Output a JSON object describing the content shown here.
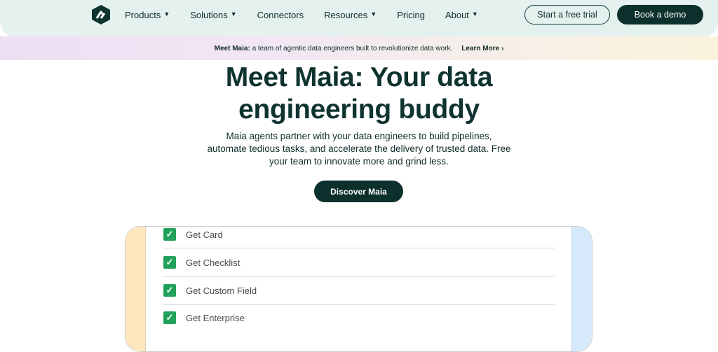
{
  "nav": {
    "items": [
      {
        "label": "Products",
        "dropdown": true
      },
      {
        "label": "Solutions",
        "dropdown": true
      },
      {
        "label": "Connectors",
        "dropdown": false
      },
      {
        "label": "Resources",
        "dropdown": true
      },
      {
        "label": "Pricing",
        "dropdown": false
      },
      {
        "label": "About",
        "dropdown": true
      }
    ],
    "trial_label": "Start a free trial",
    "demo_label": "Book a demo"
  },
  "banner": {
    "bold": "Meet Maia:",
    "text": "a team of agentic data engineers built to revolutionize data work.",
    "link": "Learn More",
    "link_icon": "chevron-right-icon"
  },
  "hero": {
    "title_line1": "Meet Maia: Your data",
    "title_line2": "engineering buddy",
    "subtitle_line1": "Maia agents partner with your data engineers to build pipelines,",
    "subtitle_line2": "automate tedious tasks, and accelerate the delivery of trusted data. Free",
    "subtitle_line3": "your team to innovate more and grind less.",
    "cta_label": "Discover Maia"
  },
  "checklist": {
    "items": [
      {
        "label": "Get Card",
        "checked": true
      },
      {
        "label": "Get Checklist",
        "checked": true
      },
      {
        "label": "Get Custom Field",
        "checked": true
      },
      {
        "label": "Get Enterprise",
        "checked": true
      }
    ]
  },
  "colors": {
    "brand_dark": "#0c302c",
    "nav_bg": "#e4f1ee",
    "check_green": "#21a15b"
  }
}
